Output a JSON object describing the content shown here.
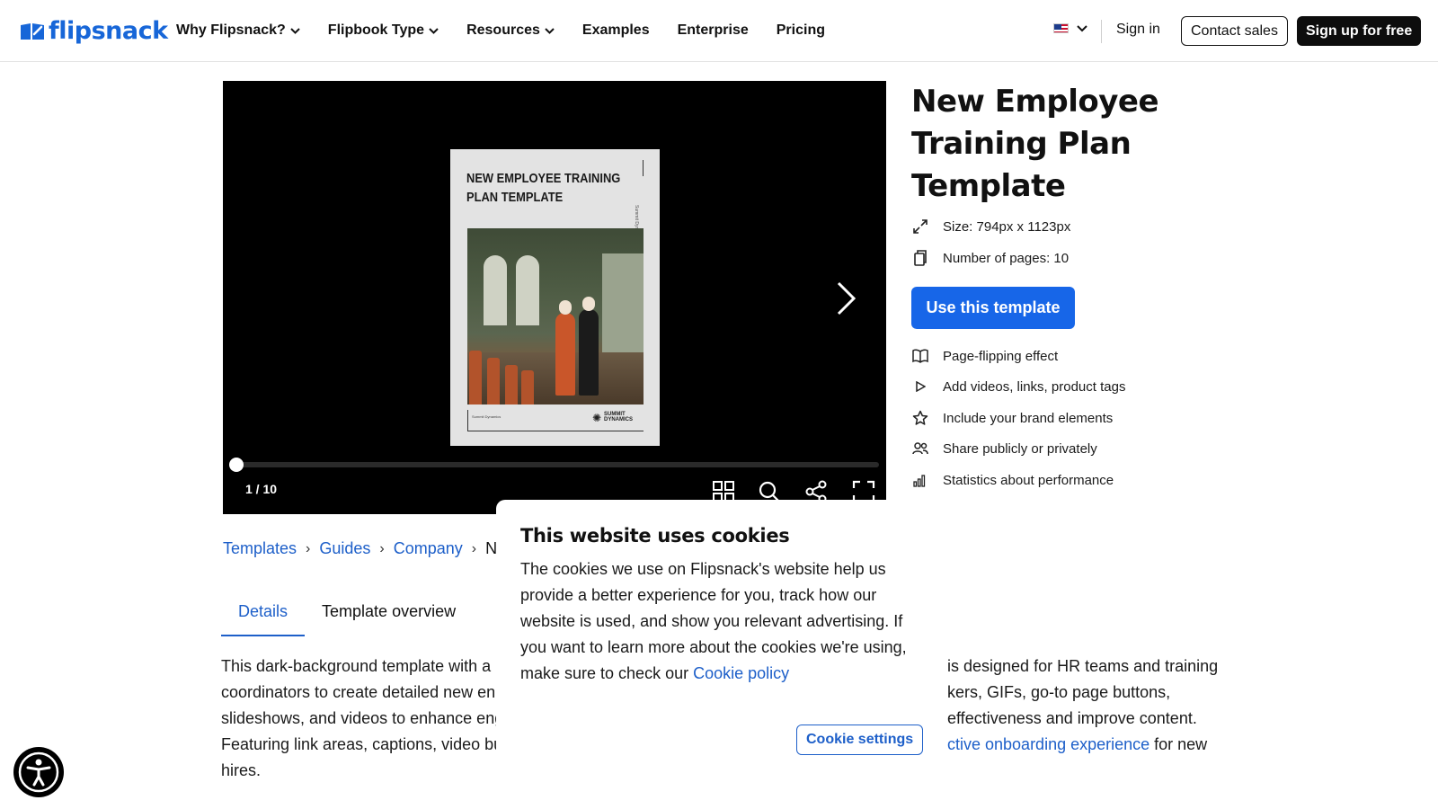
{
  "header": {
    "logo_text": "flipsnack",
    "nav": [
      {
        "label": "Why Flipsnack?",
        "has_menu": true
      },
      {
        "label": "Flipbook Type",
        "has_menu": true
      },
      {
        "label": "Resources",
        "has_menu": true
      },
      {
        "label": "Examples",
        "has_menu": false
      },
      {
        "label": "Enterprise",
        "has_menu": false
      },
      {
        "label": "Pricing",
        "has_menu": false
      }
    ],
    "language_icon": "us-flag-icon",
    "sign_in": "Sign in",
    "contact_sales": "Contact sales",
    "sign_up": "Sign up for free"
  },
  "viewer": {
    "cover_title": [
      "NEW EMPLOYEE TRAINING",
      "PLAN TEMPLATE"
    ],
    "cover_side_text": "Summit Dynamics",
    "cover_bottom_left": "Summit Dynamics",
    "cover_brand": [
      "SUMMIT",
      "DYNAMICS"
    ],
    "page_indicator": "1 / 10",
    "progress": 0.0,
    "controls": [
      "grid-icon",
      "search-icon",
      "share-icon",
      "fullscreen-icon"
    ]
  },
  "info": {
    "title": "New Employee Training Plan Template",
    "size": "Size: 794px x 1123px",
    "pages": "Number of pages: 10",
    "cta": "Use this template",
    "features": [
      "Page-flipping effect",
      "Add videos, links, product tags",
      "Include your brand elements",
      "Share publicly or privately",
      "Statistics about performance"
    ]
  },
  "breadcrumb": {
    "items": [
      "Templates",
      "Guides",
      "Company"
    ],
    "current": "Ne"
  },
  "tabs": {
    "details": "Details",
    "overview": "Template overview"
  },
  "description": {
    "line1_a": "This dark-background template with a",
    "line1_b": "is designed for HR teams and training",
    "line2_a": "coordinators to create detailed new en",
    "line2_b": "kers, GIFs, go-to page buttons,",
    "line3_a": "slideshows, and videos to enhance eng",
    "line3_b": "effectiveness and improve content.",
    "line4_a": "Featuring link areas, captions, video bu",
    "line4_link": "ctive onboarding experience",
    "line4_b": " for new",
    "line5": "hires."
  },
  "cookie": {
    "title": "This website uses cookies",
    "text": "The cookies we use on Flipsnack's website help us provide a better experience for you, track how our website is used, and show you relevant advertising. If you want to learn more about the cookies we're using, make sure to check our ",
    "link": "Cookie policy",
    "settings_button": "Cookie settings"
  }
}
